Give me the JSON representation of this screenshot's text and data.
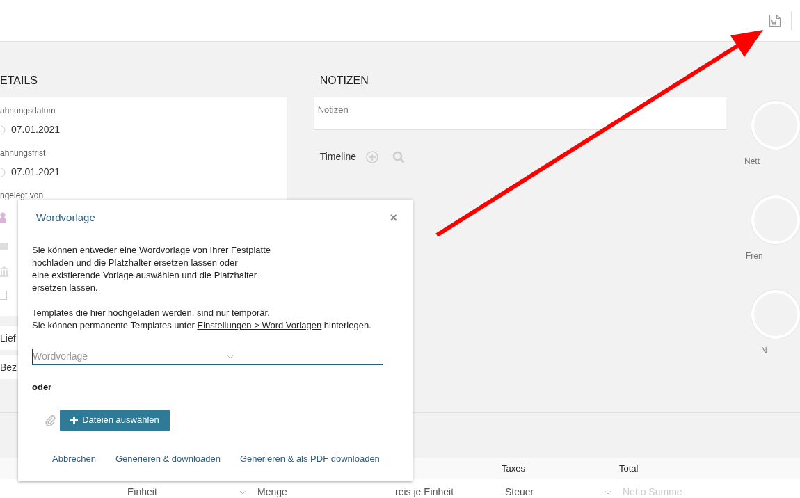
{
  "details": {
    "heading": "ETAILS",
    "fields": [
      {
        "label": "ahnungsdatum",
        "value": "07.01.2021"
      },
      {
        "label": "ahnungsfrist",
        "value": "07.01.2021"
      },
      {
        "label": "ngelegt von"
      }
    ],
    "rows": [
      "Lief",
      "Bez"
    ],
    "checkbox": {
      "checked": false
    }
  },
  "notes": {
    "heading": "NOTIZEN",
    "placeholder": "Notizen",
    "timeline": "Timeline"
  },
  "stats": [
    {
      "label": "Nett"
    },
    {
      "label": "Fren"
    },
    {
      "label": "N"
    }
  ],
  "table": {
    "columns": [
      "Taxes",
      "Total"
    ],
    "cells": [
      {
        "kind": "select",
        "value": "Einheit"
      },
      {
        "kind": "input",
        "value": "Menge"
      },
      {
        "kind": "input",
        "value": "reis je Einheit"
      },
      {
        "kind": "select",
        "value": "Steuer"
      },
      {
        "kind": "input",
        "placeholder": "Netto Summe"
      }
    ]
  },
  "dialog": {
    "title": "Wordvorlage",
    "close": "×",
    "intro": "Sie können entweder eine Wordvorlage von Ihrer Festplatte\nhochladen und die Platzhalter ersetzen lassen oder\neine existierende Vorlage auswählen und die Platzhalter\nersetzen lassen.",
    "note_before": "Templates die hier hochgeladen werden, sind nur temporär.\nSie können permanente Templates unter ",
    "note_link": "Einstellungen > Word Vorlagen",
    "note_after": " hinterlegen.",
    "select_placeholder": "Wordvorlage",
    "or": "oder",
    "upload": "Dateien auswählen",
    "actions": [
      "Abbrechen",
      "Generieren & downloaden",
      "Generieren & als PDF downloaden"
    ]
  }
}
